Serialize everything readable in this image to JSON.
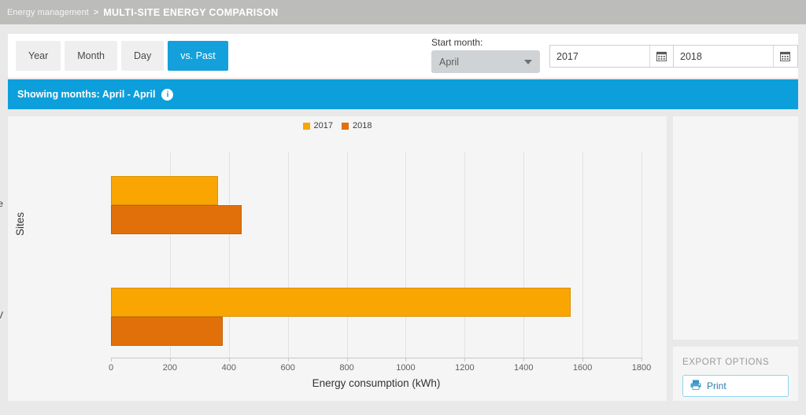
{
  "breadcrumb": {
    "parent": "Energy management",
    "separator": ">",
    "current": "MULTI-SITE ENERGY COMPARISON"
  },
  "toolbar": {
    "range_buttons": [
      {
        "label": "Year",
        "active": false
      },
      {
        "label": "Month",
        "active": false
      },
      {
        "label": "Day",
        "active": false
      },
      {
        "label": "vs. Past",
        "active": true
      }
    ],
    "start_month": {
      "label": "Start month:",
      "value": "April",
      "caret_icon": "chevron-down-icon"
    },
    "year_from": {
      "value": "2017",
      "calendar_icon": "calendar-icon"
    },
    "year_to": {
      "value": "2018",
      "calendar_icon": "calendar-icon"
    }
  },
  "notice": {
    "text": "Showing months: April - April",
    "info_icon": "info-icon",
    "background": "#0d9fdb"
  },
  "export": {
    "title": "EXPORT OPTIONS",
    "print_label": "Print",
    "print_icon": "printer-icon"
  },
  "chart_data": {
    "type": "bar",
    "orientation": "horizontal",
    "title": "",
    "xlabel": "Energy consumption (kWh)",
    "ylabel": "Sites",
    "categories": [
      "Daikin Gent Office",
      "Test iVRV"
    ],
    "series": [
      {
        "name": "2017",
        "color": "#f9a603",
        "values": [
          363,
          1560
        ]
      },
      {
        "name": "2018",
        "color": "#e2700a",
        "values": [
          443,
          379
        ]
      }
    ],
    "xlim": [
      0,
      1800
    ],
    "xticks": [
      0,
      200,
      400,
      600,
      800,
      1000,
      1200,
      1400,
      1600,
      1800
    ],
    "xtick_labels": [
      "0",
      "200",
      "400",
      "600",
      "800",
      "1000",
      "1200",
      "1400",
      "1600",
      "1800"
    ],
    "grid": true,
    "legend_position": "top-center"
  }
}
